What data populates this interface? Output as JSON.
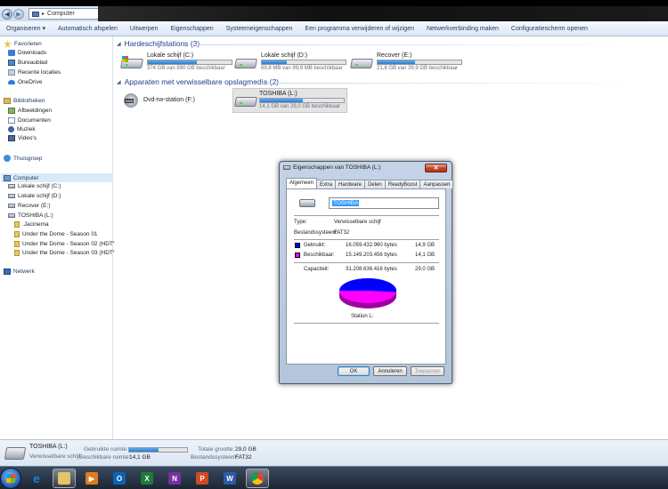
{
  "address": {
    "path": "Computer"
  },
  "toolbar": {
    "items": [
      "Organiseren ▾",
      "Automatisch afspelen",
      "Uitwerpen",
      "Eigenschappen",
      "Systeemeigenschappen",
      "Een programma verwijderen of wijzigen",
      "Netwerkverbinding maken",
      "Configuratiescherm openen"
    ]
  },
  "nav": {
    "favorites": "Favorieten",
    "downloads": "Downloads",
    "desktop": "Bureaublad",
    "recent": "Recente locaties",
    "onedrive": "OneDrive",
    "libraries": "Bibliotheken",
    "pictures": "Afbeeldingen",
    "documents": "Documenten",
    "music": "Muziek",
    "videos": "Video's",
    "homegroup": "Thuisgroep",
    "computer": "Computer",
    "drive_c": "Lokale schijf (C:)",
    "drive_d": "Lokale schijf (D:)",
    "drive_e": "Recover (E:)",
    "drive_l": "TOSHIBA (L:)",
    "folder1": ".Jacinema",
    "folder2": "Under the Dome - Season 01",
    "folder3": "Under the Dome - Season 02 (HDTV)",
    "folder4": "Under the Dome - Season 03 (HDTV)",
    "network": "Netwerk"
  },
  "content": {
    "hdd_header": "Hardeschijfstations (3)",
    "removable_header": "Apparaten met verwisselbare opslagmedia (2)",
    "drives": [
      {
        "name": "Lokale schijf (C:)",
        "size": "374 GB van 890 GB beschikbaar",
        "used_fraction": 0.58
      },
      {
        "name": "Lokale schijf (D:)",
        "size": "69,8 MB van 99,9 MB beschikbaar",
        "used_fraction": 0.3
      },
      {
        "name": "Recover (E:)",
        "size": "21,8 GB van 39,9 GB beschikbaar",
        "used_fraction": 0.45
      }
    ],
    "dvd": {
      "name": "Dvd-rw-station (F:)",
      "label": "DVD"
    },
    "toshiba": {
      "name": "TOSHIBA (L:)",
      "size": "14,1 GB van 29,0 GB beschikbaar",
      "used_fraction": 0.51
    }
  },
  "details": {
    "name": "TOSHIBA (L:)",
    "type": "Verwisselbare schijf",
    "used_label": "Gebruikte ruimte:",
    "free_label": "Beschikbare ruimte:",
    "free_value": "14,1 GB",
    "total_label": "Totale grootte:",
    "total_value": "29,0 GB",
    "fs_label": "Bestandssysteem:",
    "fs_value": "FAT32",
    "used_fraction": 0.51
  },
  "dialog": {
    "title": "Eigenschappen van TOSHIBA (L:)",
    "close": "✕",
    "tabs": [
      "Algemeen",
      "Extra",
      "Hardware",
      "Delen",
      "ReadyBoost",
      "Aanpassen"
    ],
    "name_value": "TOSHIBA",
    "type_label": "Type:",
    "type_value": "Verwisselbare schijf",
    "fs_label": "Bestandssysteem:",
    "fs_value": "FAT32",
    "used_label": "Gebruikt:",
    "used_bytes": "16.059.432.960 bytes",
    "used_gb": "14,9 GB",
    "free_label": "Beschikbaar:",
    "free_bytes": "15.149.203.456 bytes",
    "free_gb": "14,1 GB",
    "cap_label": "Capaciteit:",
    "cap_bytes": "31.208.636.416 bytes",
    "cap_gb": "29,0 GB",
    "station_label": "Station L:",
    "ok": "OK",
    "cancel": "Annuleren",
    "apply": "Toepassen",
    "used_color": "#0000ff",
    "free_color": "#ff00ff",
    "used_fraction": 0.515
  },
  "taskbar": {
    "apps": [
      {
        "icon": "internet-explorer-icon",
        "letter": "e",
        "color": "#1e7fd8"
      },
      {
        "icon": "explorer-icon",
        "letter": "",
        "color": "#e2c46a"
      },
      {
        "icon": "media-player-icon",
        "letter": "▶",
        "color": "#e07a1f"
      },
      {
        "icon": "outlook-icon",
        "letter": "O",
        "color": "#0a64b5"
      },
      {
        "icon": "excel-icon",
        "letter": "X",
        "color": "#1f7a3a"
      },
      {
        "icon": "onenote-icon",
        "letter": "N",
        "color": "#7a2f9e"
      },
      {
        "icon": "powerpoint-icon",
        "letter": "P",
        "color": "#d04a22"
      },
      {
        "icon": "word-icon",
        "letter": "W",
        "color": "#2a5ba8"
      },
      {
        "icon": "chrome-icon",
        "letter": "",
        "color": "#e0c030"
      }
    ]
  }
}
